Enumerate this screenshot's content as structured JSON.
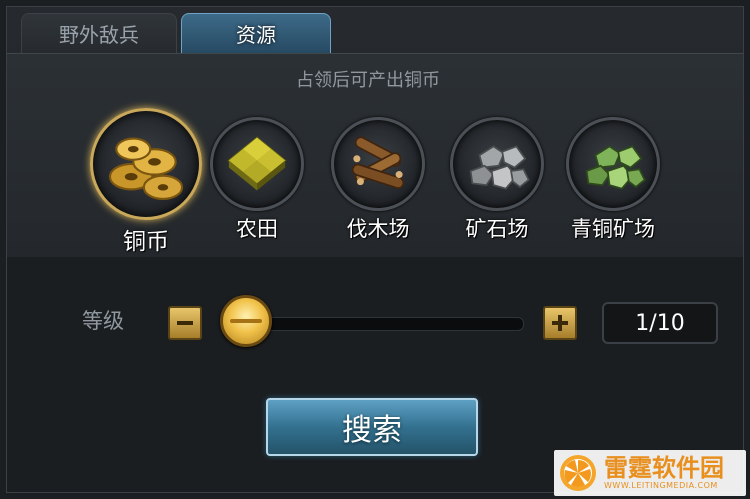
{
  "tabs": [
    {
      "label": "野外敌兵",
      "active": false
    },
    {
      "label": "资源",
      "active": true
    }
  ],
  "hint": "占领后可产出铜币",
  "resources": [
    {
      "label": "铜币",
      "icon": "copper-coins-icon",
      "selected": true
    },
    {
      "label": "农田",
      "icon": "farmland-icon",
      "selected": false
    },
    {
      "label": "伐木场",
      "icon": "lumber-icon",
      "selected": false
    },
    {
      "label": "矿石场",
      "icon": "stone-ore-icon",
      "selected": false
    },
    {
      "label": "青铜矿场",
      "icon": "bronze-ore-icon",
      "selected": false
    }
  ],
  "level": {
    "label": "等级",
    "value_text": "1/10",
    "current": 1,
    "max": 10
  },
  "search_button": "搜索",
  "watermark": {
    "title": "雷霆软件园",
    "subtitle": "WWW.LEITINGMEDIA.COM"
  },
  "colors": {
    "tab_active": "#3d6a88",
    "gold_button": "#e8c56a",
    "search_button": "#33718f",
    "watermark": "#e88f1e"
  }
}
